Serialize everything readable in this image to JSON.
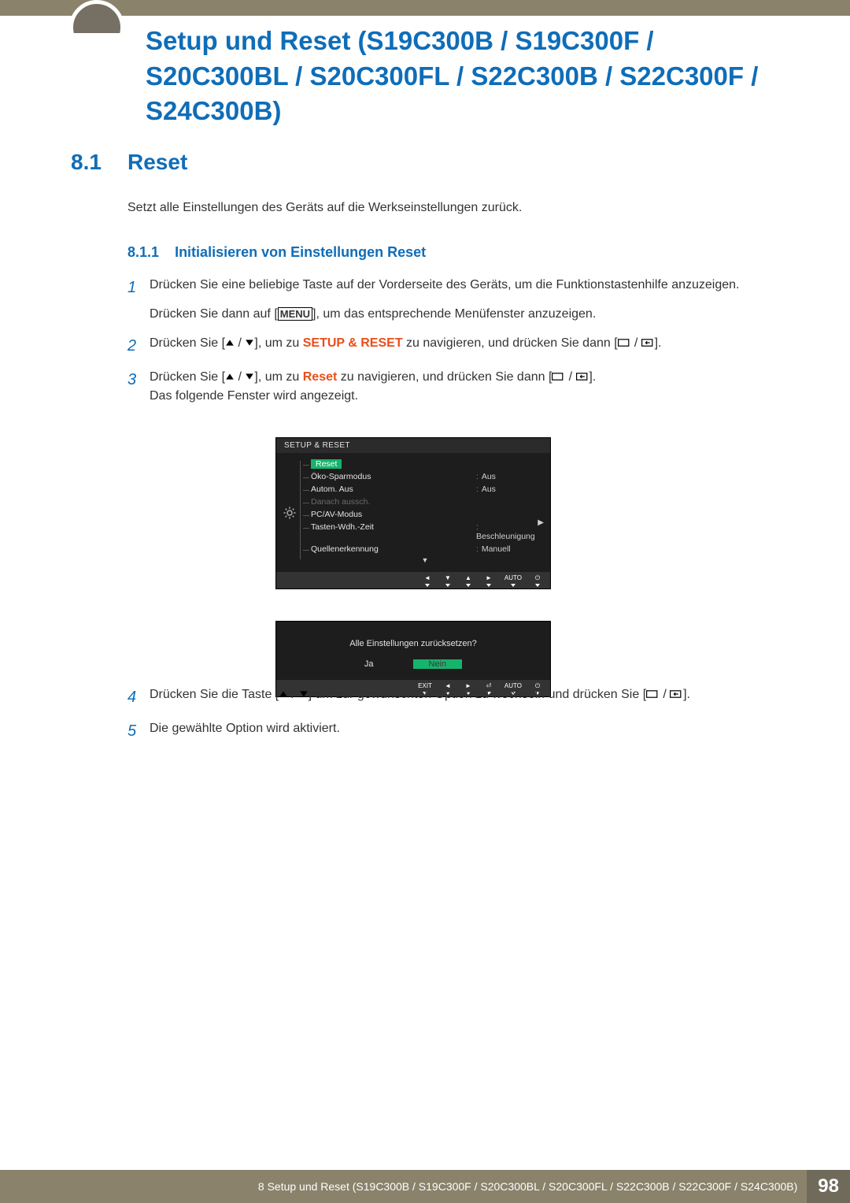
{
  "title": "Setup und Reset (S19C300B / S19C300F / S20C300BL / S20C300FL / S22C300B / S22C300F / S24C300B)",
  "section": {
    "num": "8.1",
    "title": "Reset"
  },
  "intro": "Setzt alle Einstellungen des Geräts auf die Werkseinstellungen zurück.",
  "subsection": {
    "num": "8.1.1",
    "title": "Initialisieren von Einstellungen Reset"
  },
  "steps": {
    "s1_a": "Drücken Sie eine beliebige Taste auf der Vorderseite des Geräts, um die Funktionstastenhilfe anzuzeigen.",
    "s1_b_pre": "Drücken Sie dann auf [",
    "s1_b_menu": "MENU",
    "s1_b_post": "], um das entsprechende Menüfenster anzuzeigen.",
    "s2_pre": "Drücken Sie [",
    "s2_mid": "], um zu ",
    "s2_target": "SETUP & RESET",
    "s2_post": " zu navigieren, und drücken Sie dann [",
    "s2_end": "].",
    "s3_pre": "Drücken Sie [",
    "s3_mid": "], um zu ",
    "s3_target": "Reset",
    "s3_post": " zu navigieren, und drücken Sie dann [",
    "s3_end": "].",
    "s3_note": "Das folgende Fenster wird angezeigt.",
    "s4_pre": "Drücken Sie die Taste [",
    "s4_mid": "] um zur gewünschten Option zu wechseln und drücken Sie [",
    "s4_end": "].",
    "s5": "Die gewählte Option wird aktiviert."
  },
  "osd": {
    "title": "SETUP & RESET",
    "rows": [
      {
        "label": "Reset",
        "value": "",
        "type": "selected"
      },
      {
        "label": "Öko-Sparmodus",
        "value": "Aus",
        "type": ""
      },
      {
        "label": "Autom. Aus",
        "value": "Aus",
        "type": ""
      },
      {
        "label": "Danach aussch.",
        "value": "",
        "type": "dim"
      },
      {
        "label": "PC/AV-Modus",
        "value": "",
        "type": ""
      },
      {
        "label": "Tasten-Wdh.-Zeit",
        "value": "Beschleunigung",
        "type": ""
      },
      {
        "label": "Quellenerkennung",
        "value": "Manuell",
        "type": ""
      }
    ],
    "footer": [
      "◄",
      "▼",
      "▲",
      "►",
      "AUTO",
      "⏻"
    ],
    "confirm": {
      "q": "Alle Einstellungen zurücksetzen?",
      "yes": "Ja",
      "no": "Nein"
    },
    "footer2": [
      "EXIT",
      "◄",
      "►",
      "⏎",
      "AUTO",
      "⏻"
    ]
  },
  "footer": {
    "text": "8 Setup und Reset (S19C300B / S19C300F / S20C300BL / S20C300FL / S22C300B / S22C300F / S24C300B)",
    "page": "98"
  }
}
